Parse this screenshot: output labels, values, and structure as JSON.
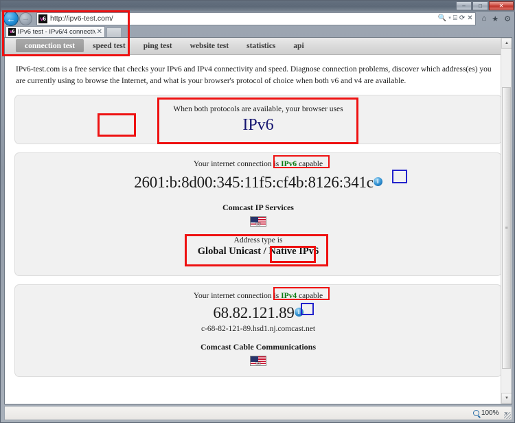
{
  "window": {
    "minimize_label": "–",
    "maximize_label": "□",
    "close_label": "✕"
  },
  "browser": {
    "back_label": "←",
    "forward_label": "→",
    "url": "http://ipv6-test.com/",
    "favicon_text_v": "v",
    "favicon_text_6": "6",
    "search_icon": "🔍",
    "dropdown_caret": "▾",
    "compat_icon": "⌸",
    "refresh_icon": "⟳",
    "stop_icon": "✕",
    "home_icon": "⌂",
    "favorites_icon": "★",
    "settings_icon": "⚙",
    "tab_title": "IPv6 test - IPv6/4 connectivi...",
    "tab_close": "✕"
  },
  "sitenav": {
    "tabs": [
      {
        "label": "connection test",
        "active": true
      },
      {
        "label": "speed test",
        "active": false
      },
      {
        "label": "ping test",
        "active": false
      },
      {
        "label": "website test",
        "active": false
      },
      {
        "label": "statistics",
        "active": false
      },
      {
        "label": "api",
        "active": false
      }
    ]
  },
  "intro": {
    "text": "IPv6-test.com is a free service that checks your IPv6 and IPv4 connectivity and speed. Diagnose connection problems, discover which address(es) you are currently using to browse the Internet, and what is your browser's protocol of choice when both v6 and v4 are available."
  },
  "protocol_panel": {
    "headline": "When both protocols are available, your browser uses",
    "protocol": "IPv6",
    "protocol_color": "#141470"
  },
  "ipv6_panel": {
    "status_prefix": "Your internet connection ",
    "status_is": "is ",
    "status_proto": "IPv6",
    "status_suffix": " capable",
    "address": "2601:b:8d00:345:11f5:cf4b:8126:341c",
    "info_icon": "i",
    "isp": "Comcast IP Services",
    "country_code": "US",
    "addrtype_head": "Address type is",
    "addrtype_value_left": "Global Unicast /",
    "addrtype_value_right": "Native IPv6"
  },
  "ipv4_panel": {
    "status_prefix": "Your internet connection ",
    "status_is": "is ",
    "status_proto": "IPv4",
    "status_suffix": " capable",
    "address": "68.82.121.89",
    "info_icon": "i",
    "hostname": "c-68-82-121-89.hsd1.nj.comcast.net",
    "isp": "Comcast Cable Communications",
    "country_code": "US"
  },
  "scrollbar": {
    "up_arrow": "▲",
    "down_arrow": "▼",
    "thumb_grip": "≡"
  },
  "statusbar": {
    "zoom": "100%",
    "caret": "▾"
  },
  "annotations": {
    "accent_red": "#ee1111",
    "accent_blue": "#2222cc"
  }
}
